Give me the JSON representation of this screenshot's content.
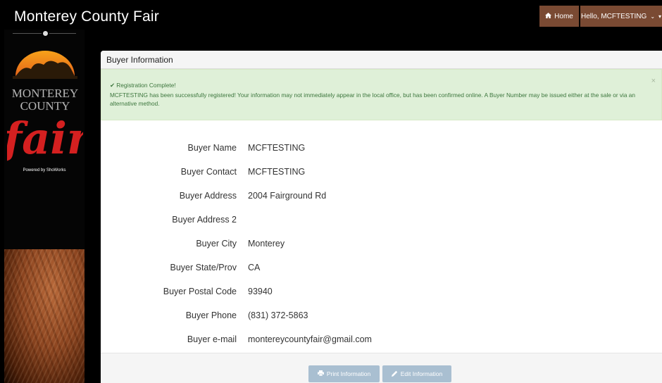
{
  "header": {
    "site_title": "Monterey County Fair",
    "home_label": "Home",
    "user_label": "Hello, MCFTESTING"
  },
  "sidebar": {
    "logo_text": [
      "MONTEREY",
      "COUNTY",
      "fair"
    ],
    "powered_by": "Powered by ShoWorks"
  },
  "panel": {
    "title": "Buyer Information",
    "alert": {
      "title": "Registration Complete!",
      "message": "MCFTESTING has been successfully registered! Your information may not immediately appear in the local office, but has been confirmed online. A Buyer Number may be issued either at the sale or via an alternative method.",
      "close": "×"
    },
    "fields": [
      {
        "label": "Buyer Name",
        "value": "MCFTESTING"
      },
      {
        "label": "Buyer Contact",
        "value": "MCFTESTING"
      },
      {
        "label": "Buyer Address",
        "value": "2004 Fairground Rd"
      },
      {
        "label": "Buyer Address 2",
        "value": ""
      },
      {
        "label": "Buyer City",
        "value": "Monterey"
      },
      {
        "label": "Buyer State/Prov",
        "value": "CA"
      },
      {
        "label": "Buyer Postal Code",
        "value": "93940"
      },
      {
        "label": "Buyer Phone",
        "value": "(831) 372-5863"
      },
      {
        "label": "Buyer e-mail",
        "value": "montereycountyfair@gmail.com"
      }
    ],
    "buttons": {
      "print": "Print Information",
      "edit": "Edit Information"
    }
  },
  "colors": {
    "nav_bg": "#7a4a33",
    "alert_bg": "#dff0d8",
    "alert_text": "#3c763d",
    "button_bg": "#a9bfd1"
  }
}
